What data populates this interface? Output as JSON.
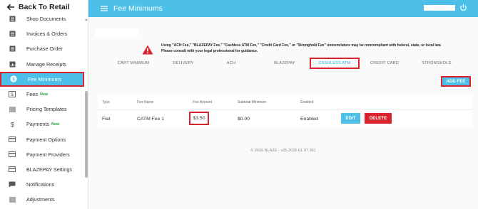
{
  "sidebar": {
    "back_label": "Back To Retail",
    "items": [
      {
        "label": "Shop Documents",
        "icon": "document-icon"
      },
      {
        "label": "Invoices & Orders",
        "icon": "list-icon"
      },
      {
        "label": "Purchase Order",
        "icon": "list-icon"
      },
      {
        "label": "Manage Receipts",
        "icon": "chart-icon"
      },
      {
        "label": "Fee Minimums",
        "icon": "dollar-circle-icon"
      },
      {
        "label": "Fees",
        "badge": "New",
        "icon": "dollar-square-icon"
      },
      {
        "label": "Pricing Templates",
        "icon": "lines-icon"
      },
      {
        "label": "Payments",
        "badge": "New",
        "icon": "dollar-icon"
      },
      {
        "label": "Payment Options",
        "icon": "card-icon"
      },
      {
        "label": "Payment Providers",
        "icon": "card-icon"
      },
      {
        "label": "BLAZEPAY Settings",
        "icon": "card-icon"
      },
      {
        "label": "Notifications",
        "icon": "chat-icon"
      },
      {
        "label": "Adjustments",
        "icon": "lines-icon"
      }
    ]
  },
  "header": {
    "title": "Fee Minimums"
  },
  "warning": {
    "line1": "Using \"ACH Fee,\" \"BLAZEPAY Fee,\" \"Cashless ATM Fee,\" \"Credit Card Fee,\" or \"Stronghold Fee\" nomenclature may be noncompliant with federal, state, or local law.",
    "line2": "Please consult with your legal professional for guidance."
  },
  "tabs": [
    {
      "label": "CART MINIMUM"
    },
    {
      "label": "DELIVERY"
    },
    {
      "label": "ACH"
    },
    {
      "label": "BLAZEPAY"
    },
    {
      "label": "CASHLESS ATM",
      "active": true
    },
    {
      "label": "CREDIT CARD"
    },
    {
      "label": "STRONGHOLD"
    }
  ],
  "add_fee_label": "ADD FEE",
  "table": {
    "headers": [
      "Type",
      "Fee Name",
      "Fee Amount",
      "Subtotal Minimum",
      "Enabled"
    ],
    "row": {
      "type": "Flat",
      "fee_name": "CATM Fee 1",
      "fee_amount": "$3.50",
      "subtotal_minimum": "$0.00",
      "enabled": "Enabled"
    },
    "edit_label": "EDIT",
    "delete_label": "DELETE"
  },
  "footer": "© 2026 BLAZE - v25.2026.01.07.361",
  "colors": {
    "accent": "#4cc0e8",
    "highlight": "#d9232e",
    "badge": "#2e9d3a"
  }
}
